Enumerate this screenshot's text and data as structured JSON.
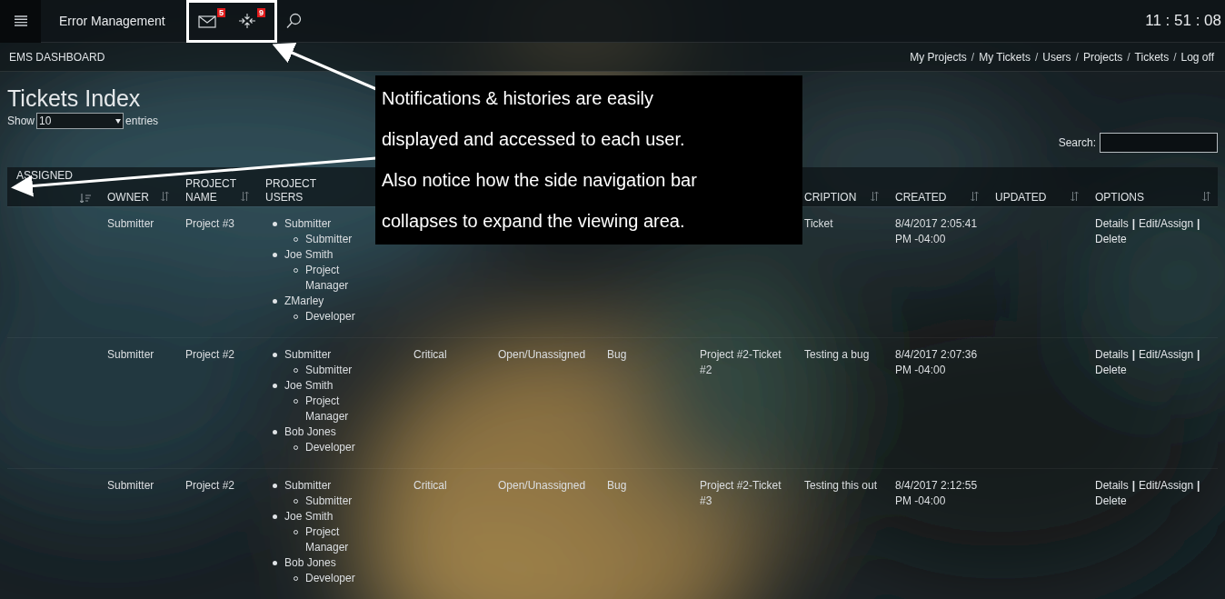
{
  "top_bar": {
    "title": "Error Management",
    "mail_count": "5",
    "history_count": "9",
    "clock": "11 : 51 : 08"
  },
  "sub_bar": {
    "title": "EMS DASHBOARD",
    "nav": [
      {
        "kind": "link",
        "text": "My Projects"
      },
      {
        "kind": "sep",
        "text": "/"
      },
      {
        "kind": "link",
        "text": "My Tickets"
      },
      {
        "kind": "sep",
        "text": "/"
      },
      {
        "kind": "link",
        "text": "Users"
      },
      {
        "kind": "sep",
        "text": "/"
      },
      {
        "kind": "link",
        "text": "Projects"
      },
      {
        "kind": "sep",
        "text": "/"
      },
      {
        "kind": "link",
        "text": "Tickets"
      },
      {
        "kind": "sep",
        "text": "/"
      },
      {
        "kind": "link",
        "text": "Log off"
      }
    ]
  },
  "page_title": "Tickets Index",
  "length_menu": {
    "before": "Show",
    "value": "10",
    "after": "entries"
  },
  "search": {
    "label": "Search:"
  },
  "table": {
    "columns": [
      {
        "label": "ASSIGNED",
        "sorted": true
      },
      {
        "label": "OWNER",
        "sorted": false
      },
      {
        "label": "PROJECT NAME",
        "sorted": false
      },
      {
        "label": "PROJECT USERS"
      },
      {},
      {},
      {},
      {},
      {
        "label": "CRIPTION",
        "sorted": false
      },
      {
        "label": "CREATED",
        "sorted": false
      },
      {
        "label": "UPDATED",
        "sorted": false
      },
      {
        "label": "OPTIONS",
        "sorted": false
      }
    ],
    "rows": [
      {
        "owner": "Submitter",
        "project_name": "Project #3",
        "project_users": [
          {
            "name": "Submitter",
            "children": [
              {
                "name": "Submitter"
              }
            ]
          },
          {
            "name": "Joe Smith",
            "children": [
              {
                "name": "Project Manager"
              }
            ]
          },
          {
            "name": "ZMarley",
            "children": [
              {
                "name": "Developer"
              }
            ]
          }
        ],
        "description": "Ticket",
        "created": "8/4/2017 2:05:41 PM -04:00",
        "options": [
          {
            "kind": "link",
            "text": "Details"
          },
          {
            "kind": "sep",
            "text": "|"
          },
          {
            "kind": "link",
            "text": "Edit/Assign"
          },
          {
            "kind": "sep",
            "text": "|"
          },
          {
            "kind": "link",
            "text": "Delete"
          }
        ]
      },
      {
        "owner": "Submitter",
        "project_name": "Project #2",
        "project_users": [
          {
            "name": "Submitter",
            "children": [
              {
                "name": "Submitter"
              }
            ]
          },
          {
            "name": "Joe Smith",
            "children": [
              {
                "name": "Project Manager"
              }
            ]
          },
          {
            "name": "Bob Jones",
            "children": [
              {
                "name": "Developer"
              }
            ]
          }
        ],
        "priority": "Critical",
        "status": "Open/Unassigned",
        "type": "Bug",
        "ticket": "Project #2-Ticket #2",
        "description": "Testing a bug",
        "created": "8/4/2017 2:07:36 PM -04:00",
        "options": [
          {
            "kind": "link",
            "text": "Details"
          },
          {
            "kind": "sep",
            "text": "|"
          },
          {
            "kind": "link",
            "text": "Edit/Assign"
          },
          {
            "kind": "sep",
            "text": "|"
          },
          {
            "kind": "link",
            "text": "Delete"
          }
        ]
      },
      {
        "owner": "Submitter",
        "project_name": "Project #2",
        "project_users": [
          {
            "name": "Submitter",
            "children": [
              {
                "name": "Submitter"
              }
            ]
          },
          {
            "name": "Joe Smith",
            "children": [
              {
                "name": "Project Manager"
              }
            ]
          },
          {
            "name": "Bob Jones",
            "children": [
              {
                "name": "Developer"
              }
            ]
          }
        ],
        "priority": "Critical",
        "status": "Open/Unassigned",
        "type": "Bug",
        "ticket": "Project #2-Ticket #3",
        "description": "Testing this out",
        "created": "8/4/2017 2:12:55 PM -04:00",
        "options": [
          {
            "kind": "link",
            "text": "Details"
          },
          {
            "kind": "sep",
            "text": "|"
          },
          {
            "kind": "link",
            "text": "Edit/Assign"
          },
          {
            "kind": "sep",
            "text": "|"
          },
          {
            "kind": "link",
            "text": "Delete"
          }
        ]
      }
    ]
  },
  "annotation": {
    "lines": [
      "Notifications & histories are easily",
      "displayed and accessed to each user.",
      "Also notice how the side navigation bar",
      "collapses to expand the viewing area."
    ]
  }
}
